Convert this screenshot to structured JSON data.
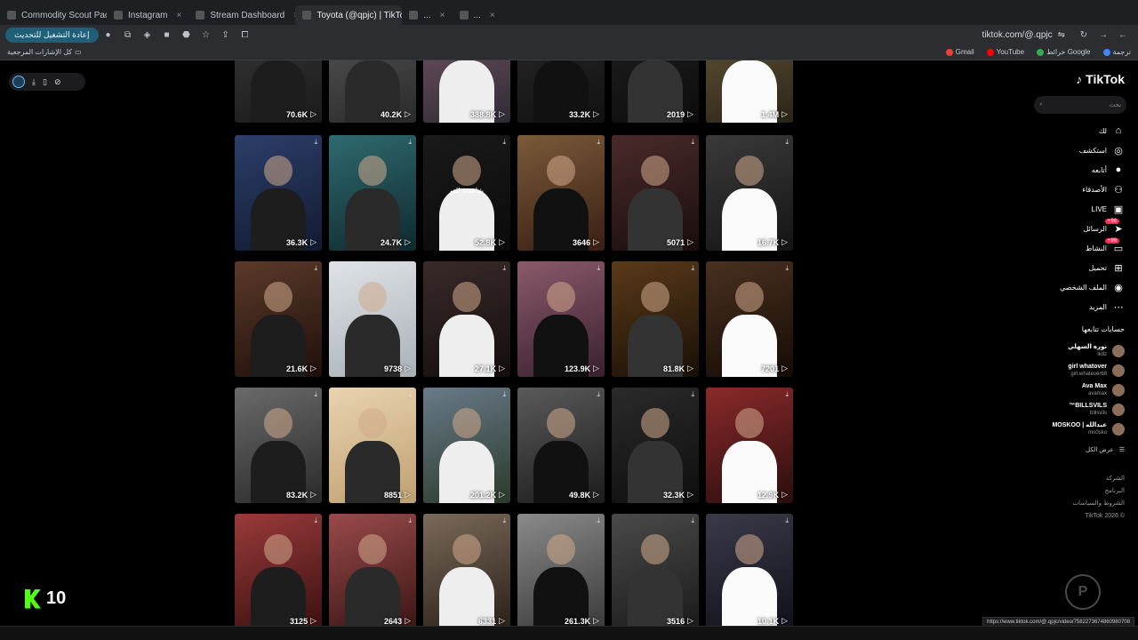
{
  "browser": {
    "tabs": [
      {
        "label": "Commodity Scout Pack",
        "active": false
      },
      {
        "label": "Instagram",
        "active": false
      },
      {
        "label": "Stream Dashboard",
        "active": false
      },
      {
        "label": "Toyota (@qpjc) | TikTok",
        "active": true
      },
      {
        "label": "...",
        "active": false
      },
      {
        "label": "...",
        "active": false
      }
    ],
    "update_button": "إعادة التشغيل للتحديث",
    "address": "tiktok.com/@.qpjc",
    "bookmarks_left": "كل الإشارات المرجعية",
    "bookmarks": [
      {
        "label": "Gmail",
        "color": "#ea4335"
      },
      {
        "label": "YouTube",
        "color": "#ff0000"
      },
      {
        "label": "خرائط Google",
        "color": "#34a853"
      },
      {
        "label": "ترجمة",
        "color": "#4285f4"
      }
    ]
  },
  "tiktok": {
    "brand": "TikTok",
    "search_placeholder": "بحث",
    "nav": [
      {
        "label": "لك",
        "icon": "home-icon",
        "glyph": "⌂",
        "badge": ""
      },
      {
        "label": "استكشف",
        "icon": "compass-icon",
        "glyph": "◎",
        "badge": ""
      },
      {
        "label": "أتابعه",
        "icon": "following-avatar-icon",
        "glyph": "●",
        "badge": ""
      },
      {
        "label": "الأصدقاء",
        "icon": "friends-icon",
        "glyph": "⚇",
        "badge": ""
      },
      {
        "label": "LIVE",
        "icon": "live-icon",
        "glyph": "▣",
        "badge": ""
      },
      {
        "label": "الرسائل",
        "icon": "messages-icon",
        "glyph": "➤",
        "badge": "99+"
      },
      {
        "label": "النشاط",
        "icon": "activity-icon",
        "glyph": "▭",
        "badge": "99+"
      },
      {
        "label": "تحميل",
        "icon": "upload-icon",
        "glyph": "⊞",
        "badge": ""
      },
      {
        "label": "الملف الشخصي",
        "icon": "profile-icon",
        "glyph": "◉",
        "badge": ""
      },
      {
        "label": "المزيد",
        "icon": "more-icon",
        "glyph": "⋯",
        "badge": ""
      }
    ],
    "following_title": "حسابات تتابعها",
    "following": [
      {
        "name": "نوره السهلي",
        "handle": "lkdz"
      },
      {
        "name": "girl whatover",
        "handle": "girl.whatever68"
      },
      {
        "name": "Ava Max",
        "handle": "avamax"
      },
      {
        "name": "BILLSVILS™",
        "handle": "billsvils"
      },
      {
        "name": "عبدالله | MOSKOO",
        "handle": "mo0sko"
      }
    ],
    "see_all": "عرض الكل",
    "footer": [
      "الشركة",
      "البرنامج",
      "الشروط والسياسات",
      "© 2026 TikTok"
    ]
  },
  "videos": [
    {
      "views": "70.6K"
    },
    {
      "views": "40.2K"
    },
    {
      "views": "388.8K"
    },
    {
      "views": "33.2K"
    },
    {
      "views": "2019"
    },
    {
      "views": "1.4M"
    },
    {
      "views": "36.3K"
    },
    {
      "views": "24.7K"
    },
    {
      "views": "52.8K",
      "overlay": "شاهدته للتو"
    },
    {
      "views": "3646"
    },
    {
      "views": "5071"
    },
    {
      "views": "16.7K"
    },
    {
      "views": "21.6K"
    },
    {
      "views": "9738"
    },
    {
      "views": "27.1K"
    },
    {
      "views": "123.9K"
    },
    {
      "views": "81.8K"
    },
    {
      "views": "7201"
    },
    {
      "views": "83.2K"
    },
    {
      "views": "8851"
    },
    {
      "views": "201.2K"
    },
    {
      "views": "49.8K"
    },
    {
      "views": "32.3K"
    },
    {
      "views": "12.9K"
    },
    {
      "views": "3125"
    },
    {
      "views": "2643"
    },
    {
      "views": "6331"
    },
    {
      "views": "261.3K"
    },
    {
      "views": "3516"
    },
    {
      "views": "10.1K"
    }
  ],
  "overlay": {
    "kick_count": "10",
    "status_url": "https://www.tiktok.com/@.qpjc/video/7582273674860980708"
  },
  "colors": {
    "accent": "#fe2c55",
    "kick_green": "#53fc18",
    "update_button_bg": "#1f5f78"
  }
}
